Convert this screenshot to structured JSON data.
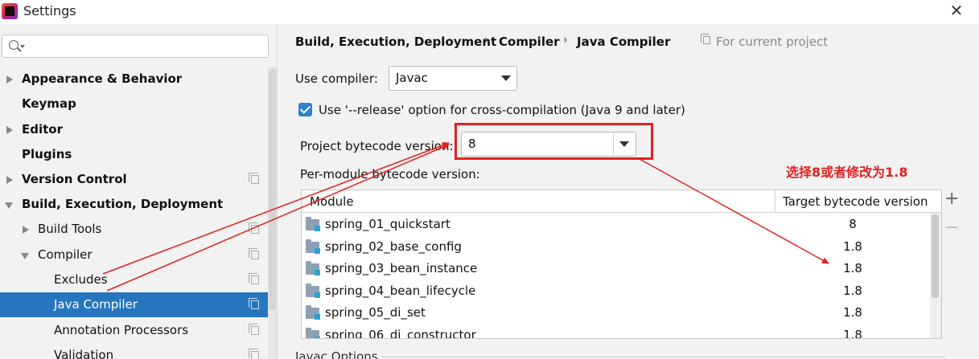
{
  "window": {
    "title": "Settings",
    "close_label": "✕"
  },
  "sidebar": {
    "search_placeholder": "",
    "items": [
      {
        "label": "Appearance & Behavior"
      },
      {
        "label": "Keymap"
      },
      {
        "label": "Editor"
      },
      {
        "label": "Plugins"
      },
      {
        "label": "Version Control"
      },
      {
        "label": "Build, Execution, Deployment"
      },
      {
        "label": "Build Tools"
      },
      {
        "label": "Compiler"
      },
      {
        "label": "Excludes"
      },
      {
        "label": "Java Compiler"
      },
      {
        "label": "Annotation Processors"
      },
      {
        "label": "Validation"
      }
    ],
    "selected": "Java Compiler"
  },
  "breadcrumb": {
    "items": [
      "Build, Execution, Deployment",
      "Compiler",
      "Java Compiler"
    ],
    "separator": "›",
    "scope": "For current project"
  },
  "form": {
    "use_compiler_label": "Use compiler:",
    "use_compiler_value": "Javac",
    "release_option_label": "Use '--release' option for cross-compilation (Java 9 and later)",
    "release_option_checked": true,
    "bytecode_version_label": "Project bytecode version:",
    "bytecode_version_value": "8",
    "per_module_label": "Per-module bytecode version:"
  },
  "module_table": {
    "columns": [
      "Module",
      "Target bytecode version"
    ],
    "rows": [
      {
        "module": "spring_01_quickstart",
        "version": "8"
      },
      {
        "module": "spring_02_base_config",
        "version": "1.8"
      },
      {
        "module": "spring_03_bean_instance",
        "version": "1.8"
      },
      {
        "module": "spring_04_bean_lifecycle",
        "version": "1.8"
      },
      {
        "module": "spring_05_di_set",
        "version": "1.8"
      },
      {
        "module": "spring_06_di_constructor",
        "version": "1.8"
      }
    ],
    "add_label": "+",
    "remove_label": "−"
  },
  "annotation": {
    "text": "选择8或者修改为1.8",
    "color": "#e42020"
  },
  "section": {
    "javac_options": "Javac Options"
  },
  "colors": {
    "selection": "#2675bf",
    "checkbox": "#2f7fd3",
    "highlight": "#e42020"
  }
}
